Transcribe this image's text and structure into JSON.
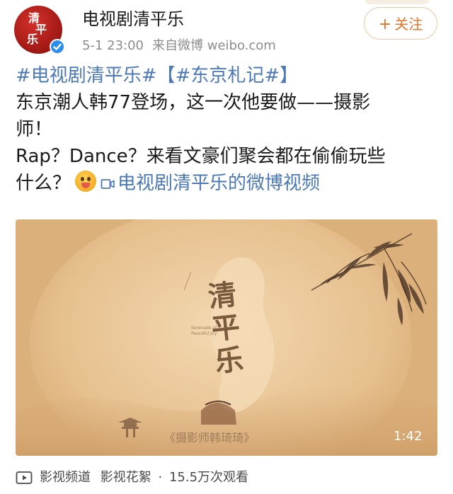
{
  "header": {
    "account_name": "电视剧清平乐",
    "avatar_text": "清平乐",
    "timestamp": "5-1 23:00",
    "source": "来自微博 weibo.com",
    "follow_label": "关注",
    "follow_prefix": "+"
  },
  "post": {
    "tag_show": "#电视剧清平乐#",
    "tag_topic": "【#东京札记#】",
    "line1_text": "东京潮人韩77登场，这一次他要做——摄影",
    "line2_text": "师！",
    "line3_text": "Rap？Dance？来看文豪们聚会都在偷偷玩些",
    "line4_text": "什么？",
    "video_link": "电视剧清平乐的微博视频"
  },
  "video": {
    "title_text": "清平乐",
    "subtitle": "《摄影师韩琦琦》",
    "duration": "1:42"
  },
  "footer": {
    "channel": "影视频道",
    "category": "影视花絮",
    "separator": "·",
    "views": "15.5万次观看"
  },
  "colors": {
    "link": "#4b78b6",
    "follow_accent": "#e8742c",
    "video_bg": "#ddb27c",
    "avatar_red": "#c0231c",
    "verified_blue": "#2d8cf0"
  }
}
